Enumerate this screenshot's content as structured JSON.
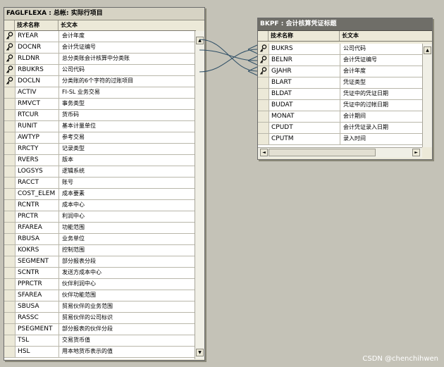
{
  "table1": {
    "title": "FAGLFLEXA : 总帐: 实际行项目",
    "col_name": "技术名称",
    "col_desc": "长文本",
    "rows": [
      {
        "name": "RYEAR",
        "desc": "会计年度",
        "key": true
      },
      {
        "name": "DOCNR",
        "desc": "会计凭证编号",
        "key": true
      },
      {
        "name": "RLDNR",
        "desc": "总分类账会计核算中分类账",
        "key": true
      },
      {
        "name": "RBUKRS",
        "desc": "公司代码",
        "key": true
      },
      {
        "name": "DOCLN",
        "desc": "分类账的6个字符的过账项目",
        "key": true
      },
      {
        "name": "ACTIV",
        "desc": "FI-SL 业务交易",
        "key": false
      },
      {
        "name": "RMVCT",
        "desc": "事务类型",
        "key": false
      },
      {
        "name": "RTCUR",
        "desc": "货币码",
        "key": false
      },
      {
        "name": "RUNIT",
        "desc": "基本计量单位",
        "key": false
      },
      {
        "name": "AWTYP",
        "desc": "参考交易",
        "key": false
      },
      {
        "name": "RRCTY",
        "desc": "记录类型",
        "key": false
      },
      {
        "name": "RVERS",
        "desc": "版本",
        "key": false
      },
      {
        "name": "LOGSYS",
        "desc": "逻辑系统",
        "key": false
      },
      {
        "name": "RACCT",
        "desc": "账号",
        "key": false
      },
      {
        "name": "COST_ELEM",
        "desc": "成本要素",
        "key": false
      },
      {
        "name": "RCNTR",
        "desc": "成本中心",
        "key": false
      },
      {
        "name": "PRCTR",
        "desc": "利润中心",
        "key": false
      },
      {
        "name": "RFAREA",
        "desc": "功能范围",
        "key": false
      },
      {
        "name": "RBUSA",
        "desc": "业务单位",
        "key": false
      },
      {
        "name": "KOKRS",
        "desc": "控制范围",
        "key": false
      },
      {
        "name": "SEGMENT",
        "desc": "部分报表分段",
        "key": false
      },
      {
        "name": "SCNTR",
        "desc": "发送方成本中心",
        "key": false
      },
      {
        "name": "PPRCTR",
        "desc": "伙伴利润中心",
        "key": false
      },
      {
        "name": "SFAREA",
        "desc": "伙伴功能范围",
        "key": false
      },
      {
        "name": "SBUSA",
        "desc": "贸易伙伴的业务范围",
        "key": false
      },
      {
        "name": "RASSC",
        "desc": "贸易伙伴的公司标识",
        "key": false
      },
      {
        "name": "PSEGMENT",
        "desc": "部分报表的伙伴分段",
        "key": false
      },
      {
        "name": "TSL",
        "desc": "交易货币值",
        "key": false
      },
      {
        "name": "HSL",
        "desc": "用本地货币表示的值",
        "key": false
      }
    ],
    "scroll_up": "▲",
    "scroll_down": "▼"
  },
  "table2": {
    "title": "BKPF : 会计核算凭证标题",
    "col_name": "技术名称",
    "col_desc": "长文本",
    "rows": [
      {
        "name": "BUKRS",
        "desc": "公司代码",
        "key": true
      },
      {
        "name": "BELNR",
        "desc": "会计凭证编号",
        "key": true
      },
      {
        "name": "GJAHR",
        "desc": "会计年度",
        "key": true
      },
      {
        "name": "BLART",
        "desc": "凭证类型",
        "key": false
      },
      {
        "name": "BLDAT",
        "desc": "凭证中的凭证日期",
        "key": false
      },
      {
        "name": "BUDAT",
        "desc": "凭证中的过帐日期",
        "key": false
      },
      {
        "name": "MONAT",
        "desc": "会计期间",
        "key": false
      },
      {
        "name": "CPUDT",
        "desc": "会计凭证录入日期",
        "key": false
      },
      {
        "name": "CPUTM",
        "desc": "录入时间",
        "key": false
      }
    ],
    "scroll_up": "▲",
    "scroll_down": "▼",
    "scroll_left": "◄",
    "scroll_right": "►"
  },
  "watermark": "CSDN @chenchihwen"
}
